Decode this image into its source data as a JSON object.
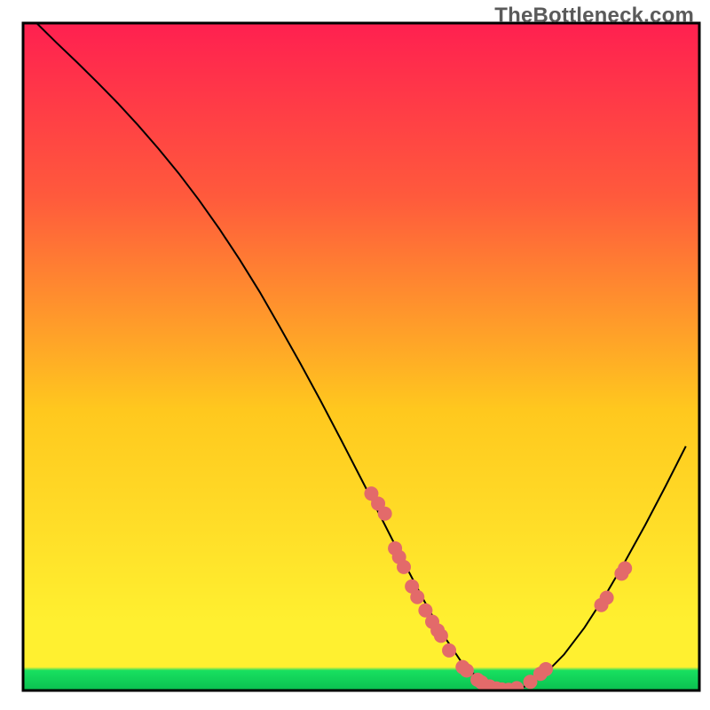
{
  "watermark": "TheBottleneck.com",
  "chart_data": {
    "type": "line",
    "title": "",
    "xlabel": "",
    "ylabel": "",
    "xlim": [
      0,
      100
    ],
    "ylim": [
      0,
      100
    ],
    "x": [
      2,
      5,
      8,
      11,
      14,
      17,
      20,
      23,
      26,
      29,
      32,
      35,
      38,
      41,
      44,
      47,
      50,
      53,
      56,
      59,
      62,
      65,
      68,
      71,
      74,
      77,
      80,
      83,
      86,
      89,
      92,
      95,
      98
    ],
    "values": [
      100,
      97,
      94.1,
      91.1,
      88.0,
      84.7,
      81.2,
      77.5,
      73.5,
      69.2,
      64.6,
      59.7,
      54.4,
      49.0,
      43.4,
      37.6,
      31.7,
      25.8,
      19.8,
      14.0,
      8.5,
      4.0,
      1.2,
      0.1,
      0.5,
      2.3,
      5.4,
      9.4,
      14.1,
      19.3,
      24.8,
      30.6,
      36.6
    ],
    "minimum_x": 71,
    "markers": [
      {
        "x": 51.5,
        "y": 29.5
      },
      {
        "x": 52.5,
        "y": 28.0
      },
      {
        "x": 53.5,
        "y": 26.5
      },
      {
        "x": 55.0,
        "y": 21.3
      },
      {
        "x": 55.6,
        "y": 20.0
      },
      {
        "x": 56.3,
        "y": 18.5
      },
      {
        "x": 57.5,
        "y": 15.6
      },
      {
        "x": 58.3,
        "y": 14.0
      },
      {
        "x": 59.5,
        "y": 12.0
      },
      {
        "x": 60.5,
        "y": 10.3
      },
      {
        "x": 61.3,
        "y": 9.0
      },
      {
        "x": 61.8,
        "y": 8.2
      },
      {
        "x": 63.0,
        "y": 6.0
      },
      {
        "x": 65.0,
        "y": 3.5
      },
      {
        "x": 65.6,
        "y": 3.0
      },
      {
        "x": 67.2,
        "y": 1.6
      },
      {
        "x": 67.8,
        "y": 1.2
      },
      {
        "x": 69.0,
        "y": 0.6
      },
      {
        "x": 70.0,
        "y": 0.3
      },
      {
        "x": 70.8,
        "y": 0.15
      },
      {
        "x": 71.8,
        "y": 0.1
      },
      {
        "x": 73.0,
        "y": 0.35
      },
      {
        "x": 75.0,
        "y": 1.3
      },
      {
        "x": 76.5,
        "y": 2.5
      },
      {
        "x": 77.3,
        "y": 3.2
      },
      {
        "x": 85.5,
        "y": 12.8
      },
      {
        "x": 86.3,
        "y": 13.9
      },
      {
        "x": 88.5,
        "y": 17.5
      },
      {
        "x": 89.0,
        "y": 18.3
      }
    ],
    "marker_color": "#e36a6a",
    "marker_radius": 8,
    "curve_color": "#000000",
    "curve_width": 2,
    "gradient_top": "#ff2050",
    "gradient_mid_upper": "#ff5a3c",
    "gradient_mid": "#ffc81e",
    "gradient_mid_lower": "#fff030",
    "gradient_bottom_band": "#18e060",
    "gradient_bottom_band2": "#0ac050",
    "frame_color": "#000000",
    "frame_inset_left": 26,
    "frame_inset_top": 26,
    "frame_inset_right": 12,
    "frame_inset_bottom": 22,
    "frame_width": 762,
    "frame_height": 752
  }
}
